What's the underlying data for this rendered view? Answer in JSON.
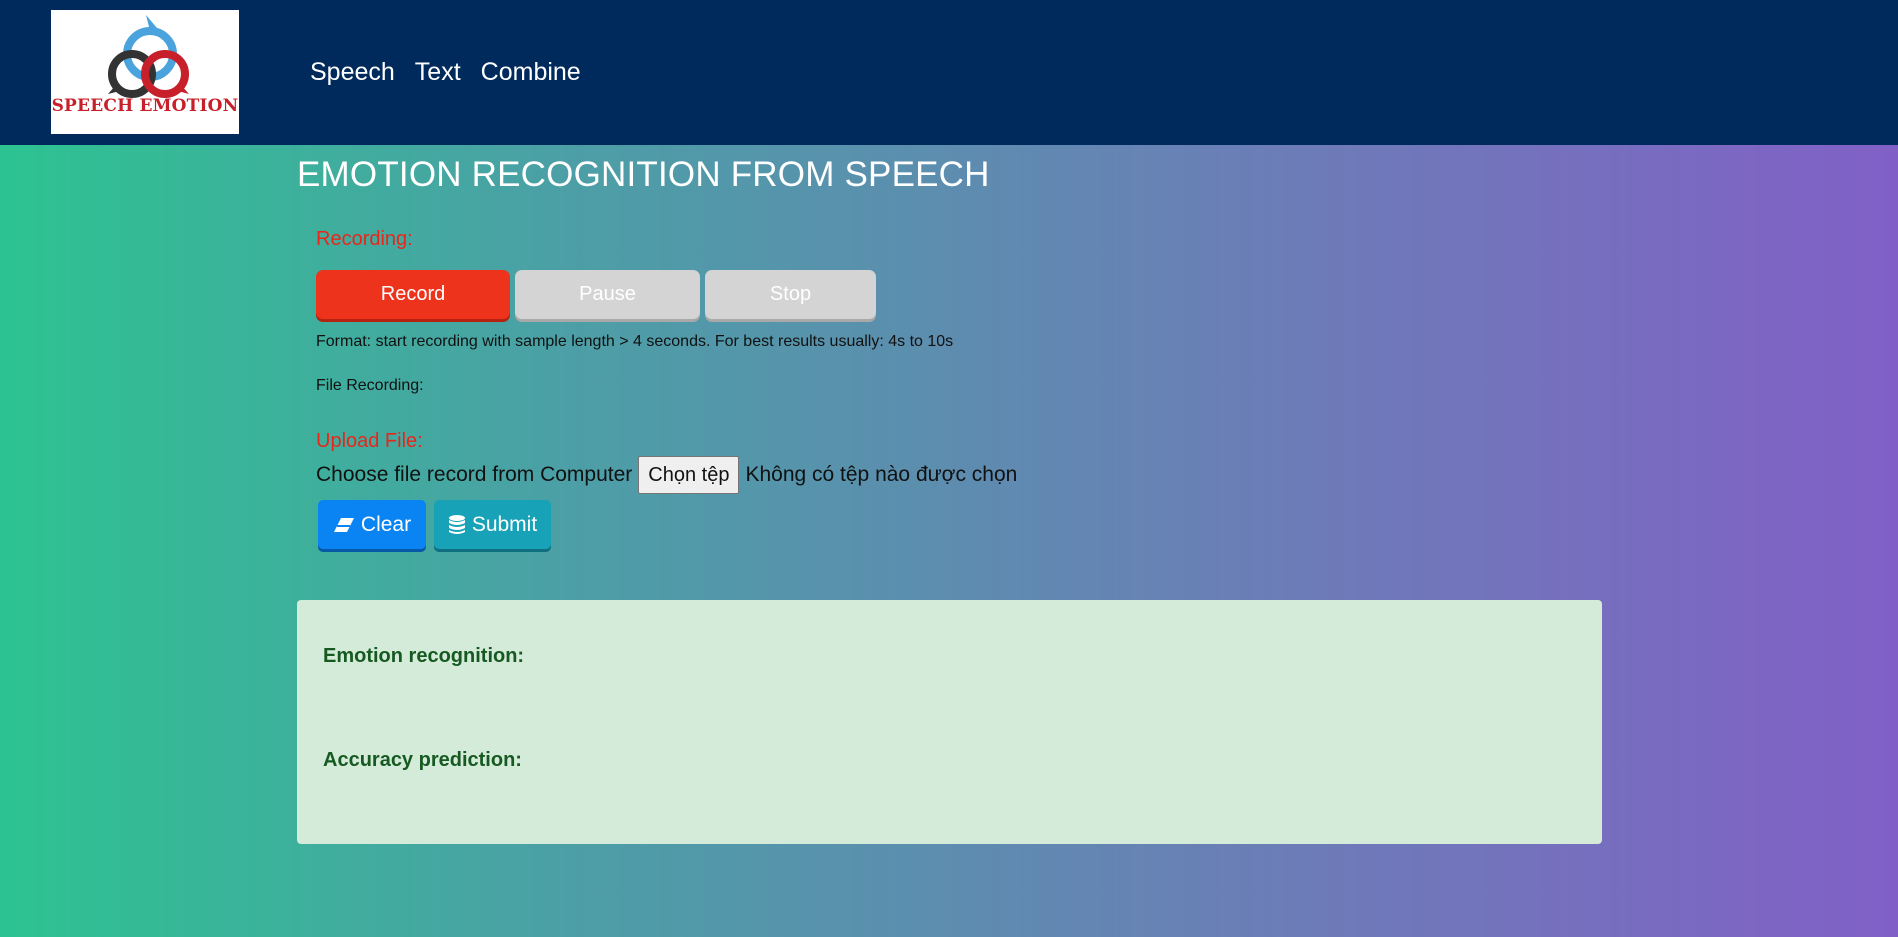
{
  "header": {
    "logo_text": "SPEECH EMOTION",
    "nav": [
      {
        "label": "Speech"
      },
      {
        "label": "Text"
      },
      {
        "label": "Combine"
      }
    ]
  },
  "main": {
    "title": "EMOTION RECOGNITION FROM SPEECH",
    "recording": {
      "label": "Recording:",
      "record_label": "Record",
      "pause_label": "Pause",
      "stop_label": "Stop",
      "format_note": "Format: start recording with sample length > 4 seconds. For best results usually: 4s to 10s",
      "file_recording_label": "File Recording:"
    },
    "upload": {
      "label": "Upload File:",
      "choose_label": "Choose file record from Computer",
      "file_button": "Chọn tệp",
      "file_status": "Không có tệp nào được chọn",
      "clear_label": "Clear",
      "submit_label": "Submit"
    },
    "results": {
      "emotion_label": "Emotion recognition:",
      "accuracy_label": "Accuracy prediction:"
    }
  },
  "colors": {
    "navbar": "#002a5c",
    "record": "#ee331c",
    "clear": "#0a84f2",
    "submit": "#17a2b8",
    "section_label": "#e8261c",
    "result_bg": "#d4ebd9"
  }
}
